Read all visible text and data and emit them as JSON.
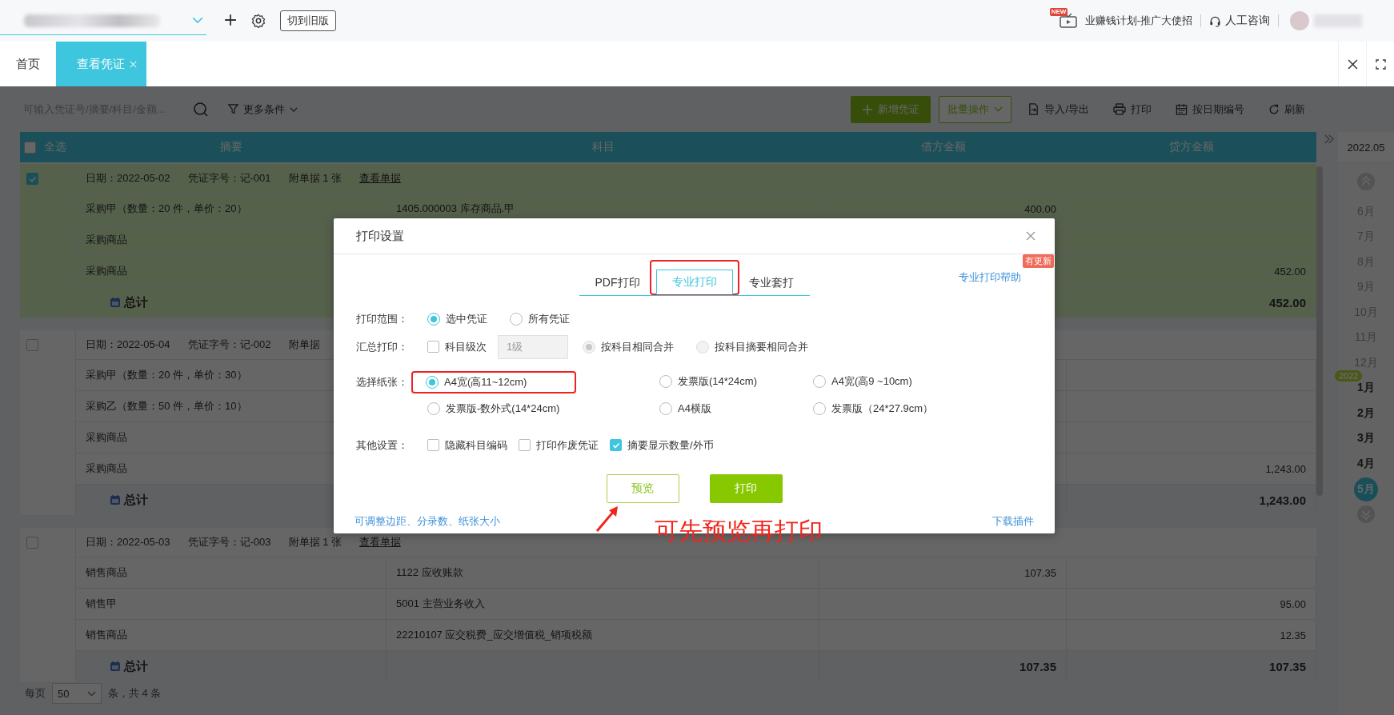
{
  "top_bar": {
    "old_version_button": "切到旧版",
    "promo": {
      "badge": "NEW",
      "text": "业赚钱计划-推广大使招"
    },
    "consult": "人工咨询"
  },
  "tabs": [
    {
      "label": "首页",
      "selected": false,
      "closable": false
    },
    {
      "label": "查看凭证",
      "selected": true,
      "closable": true
    }
  ],
  "toolbar": {
    "search": {
      "placeholder": "可输入凭证号/摘要/科目/金额..."
    },
    "filter": "更多条件",
    "buttons": [
      {
        "label": "新增凭证",
        "kind": "primary"
      },
      {
        "label": "批量操作",
        "kind": "dropdown"
      },
      {
        "label": "导入/导出",
        "kind": "import"
      },
      {
        "label": "打印",
        "kind": "print"
      },
      {
        "label": "按日期编号",
        "kind": "calendar"
      },
      {
        "label": "刷新",
        "kind": "refresh"
      }
    ]
  },
  "table": {
    "select_all": {
      "label": "全选",
      "checked": false
    },
    "columns": [
      "摘要",
      "科目",
      "借方金额",
      "贷方金额"
    ],
    "vouchers": [
      {
        "selected": true,
        "date": "日期：2022-05-02",
        "number": "凭证字号：记-001",
        "attachments": "附单据 1 张",
        "view_link": "查看单据",
        "entries": [
          {
            "summary": "采购甲（数量：20 件，单价：20）",
            "account": "1405.000003 库存商品.甲",
            "debit": "400.00"
          },
          {
            "summary": "采购商品"
          },
          {
            "summary": "采购商品",
            "credit": "452.00"
          }
        ],
        "total": {
          "label": "总计",
          "credit": "452.00"
        }
      },
      {
        "selected": false,
        "date": "日期：2022-05-04",
        "number": "凭证字号：记-002",
        "attachments": "附单据",
        "entries": [
          {
            "summary": "采购甲（数量：20 件，单价：30）"
          },
          {
            "summary": "采购乙（数量：50 件，单价：10）"
          },
          {
            "summary": "采购商品"
          },
          {
            "summary": "采购商品",
            "credit": "1,243.00"
          }
        ],
        "total": {
          "label": "总计",
          "credit": "1,243.00"
        }
      },
      {
        "selected": false,
        "date": "日期：2022-05-03",
        "number": "凭证字号：记-003",
        "attachments": "附单据 1 张",
        "view_link": "查看单据",
        "entries": [
          {
            "summary": "销售商品",
            "account": "1122 应收账款",
            "debit": "107.35"
          },
          {
            "summary": "销售甲",
            "account": "5001 主营业务收入",
            "credit": "95.00"
          },
          {
            "summary": "销售商品",
            "account": "22210107 应交税费_应交增值税_销项税额",
            "credit": "12.35"
          }
        ],
        "total": {
          "label": "总计",
          "debit": "107.35",
          "credit": "107.35"
        }
      }
    ]
  },
  "pagination": {
    "per_page_label": "每页",
    "page_size": "50",
    "total": "条，共 4 条"
  },
  "date_rail": {
    "current": "2022.05",
    "items": [
      {
        "kind": "month",
        "label": "6月",
        "faded": true,
        "selected": false
      },
      {
        "kind": "month",
        "label": "7月",
        "faded": true,
        "selected": false
      },
      {
        "kind": "month",
        "label": "8月",
        "faded": true,
        "selected": false
      },
      {
        "kind": "month",
        "label": "9月",
        "faded": true,
        "selected": false
      },
      {
        "kind": "month",
        "label": "10月",
        "faded": true,
        "selected": false
      },
      {
        "kind": "month",
        "label": "11月",
        "faded": true,
        "selected": false
      },
      {
        "kind": "month",
        "label": "12月",
        "faded": true,
        "selected": false
      },
      {
        "kind": "year",
        "label": "2022"
      },
      {
        "kind": "month",
        "label": "1月",
        "faded": false,
        "selected": false
      },
      {
        "kind": "month",
        "label": "2月",
        "faded": false,
        "selected": false
      },
      {
        "kind": "month",
        "label": "3月",
        "faded": false,
        "selected": false
      },
      {
        "kind": "month",
        "label": "4月",
        "faded": false,
        "selected": false
      },
      {
        "kind": "month",
        "label": "5月",
        "faded": false,
        "selected": true
      }
    ]
  },
  "dialog": {
    "title": "打印设置",
    "tabs": [
      {
        "label": "PDF打印",
        "selected": false,
        "highlighted": false
      },
      {
        "label": "专业打印",
        "selected": true,
        "highlighted": true
      },
      {
        "label": "专业套打",
        "selected": false,
        "highlighted": false
      }
    ],
    "help_link": "专业打印帮助",
    "help_badge": "有更新",
    "rows": [
      {
        "kind": "radio",
        "label": "打印范围：",
        "options": [
          {
            "label": "选中凭证",
            "selected": true,
            "disabled": false
          },
          {
            "label": "所有凭证",
            "selected": false,
            "disabled": false
          }
        ]
      },
      {
        "kind": "summary",
        "label": "汇总打印：",
        "checkbox": {
          "label": "科目级次",
          "checked": false
        },
        "level_field": {
          "value": "1级",
          "disabled": true
        },
        "options": [
          {
            "label": "按科目相同合并",
            "selected": true,
            "disabled": true
          },
          {
            "label": "按科目摘要相同合并",
            "selected": false,
            "disabled": true
          }
        ]
      },
      {
        "kind": "paper",
        "label": "选择纸张：",
        "options": [
          {
            "label": "A4宽(高11~12cm)",
            "selected": true,
            "highlighted": true
          },
          {
            "label": "发票版(14*24cm)",
            "selected": false,
            "highlighted": false
          },
          {
            "label": "A4宽(高9 ~10cm)",
            "selected": false,
            "highlighted": false
          },
          {
            "label": "发票版-数外式(14*24cm)",
            "selected": false,
            "highlighted": false
          },
          {
            "label": "A4横版",
            "selected": false,
            "highlighted": false
          },
          {
            "label": "发票版（24*27.9cm）",
            "selected": false,
            "highlighted": false
          }
        ]
      },
      {
        "kind": "checks",
        "label": "其他设置：",
        "options": [
          {
            "label": "隐藏科目编码",
            "checked": false
          },
          {
            "label": "打印作废凭证",
            "checked": false
          },
          {
            "label": "摘要显示数量/外币",
            "checked": true
          }
        ]
      }
    ],
    "buttons": [
      {
        "label": "预览",
        "kind": "secondary"
      },
      {
        "label": "打印",
        "kind": "primary"
      }
    ],
    "footer_link": "可调整边距、分录数、纸张大小",
    "download_link": "下载插件"
  },
  "annotation": {
    "text": "可先预览再打印"
  }
}
